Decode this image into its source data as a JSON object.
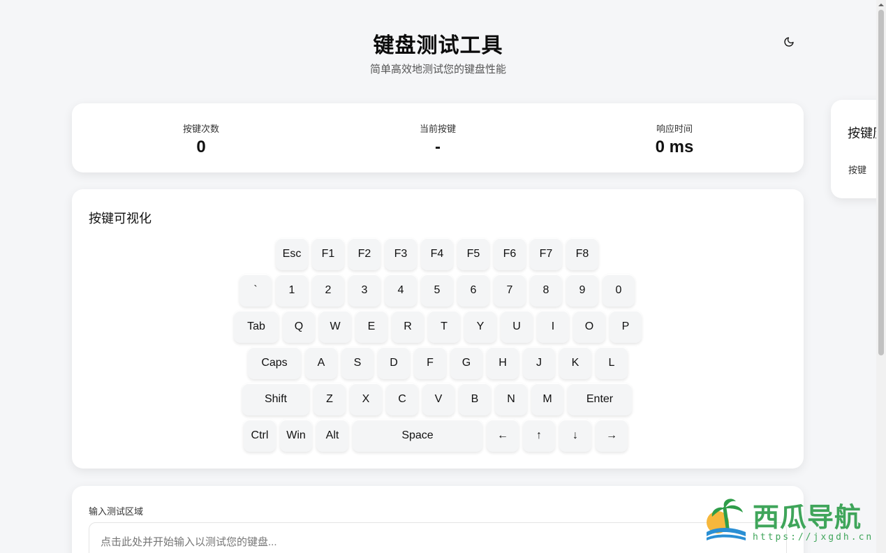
{
  "header": {
    "title": "键盘测试工具",
    "subtitle": "简单高效地测试您的键盘性能",
    "theme_icon": "moon-icon"
  },
  "stats": [
    {
      "label": "按键次数",
      "value": "0"
    },
    {
      "label": "当前按键",
      "value": "-"
    },
    {
      "label": "响应时间",
      "value": "0 ms"
    }
  ],
  "keyboard": {
    "title": "按键可视化",
    "rows": [
      [
        "Esc",
        "F1",
        "F2",
        "F3",
        "F4",
        "F5",
        "F6",
        "F7",
        "F8"
      ],
      [
        "`",
        "1",
        "2",
        "3",
        "4",
        "5",
        "6",
        "7",
        "8",
        "9",
        "0"
      ],
      [
        "Tab",
        "Q",
        "W",
        "E",
        "R",
        "T",
        "Y",
        "U",
        "I",
        "O",
        "P"
      ],
      [
        "Caps",
        "A",
        "S",
        "D",
        "F",
        "G",
        "H",
        "J",
        "K",
        "L"
      ],
      [
        "Shift",
        "Z",
        "X",
        "C",
        "V",
        "B",
        "N",
        "M",
        "Enter"
      ],
      [
        "Ctrl",
        "Win",
        "Alt",
        "Space",
        "←",
        "↑",
        "↓",
        "→"
      ]
    ]
  },
  "input_area": {
    "label": "输入测试区域",
    "placeholder": "点击此处并开始输入以测试您的键盘..."
  },
  "side_panel": {
    "title": "按键历",
    "column": "按键"
  },
  "watermark": {
    "text": "西瓜导航",
    "url": "https://jxgdh.cn"
  },
  "colors": {
    "background": "#f5f6f8",
    "card": "#ffffff",
    "key": "#f4f5f6",
    "watermark": "#3fa55a"
  }
}
